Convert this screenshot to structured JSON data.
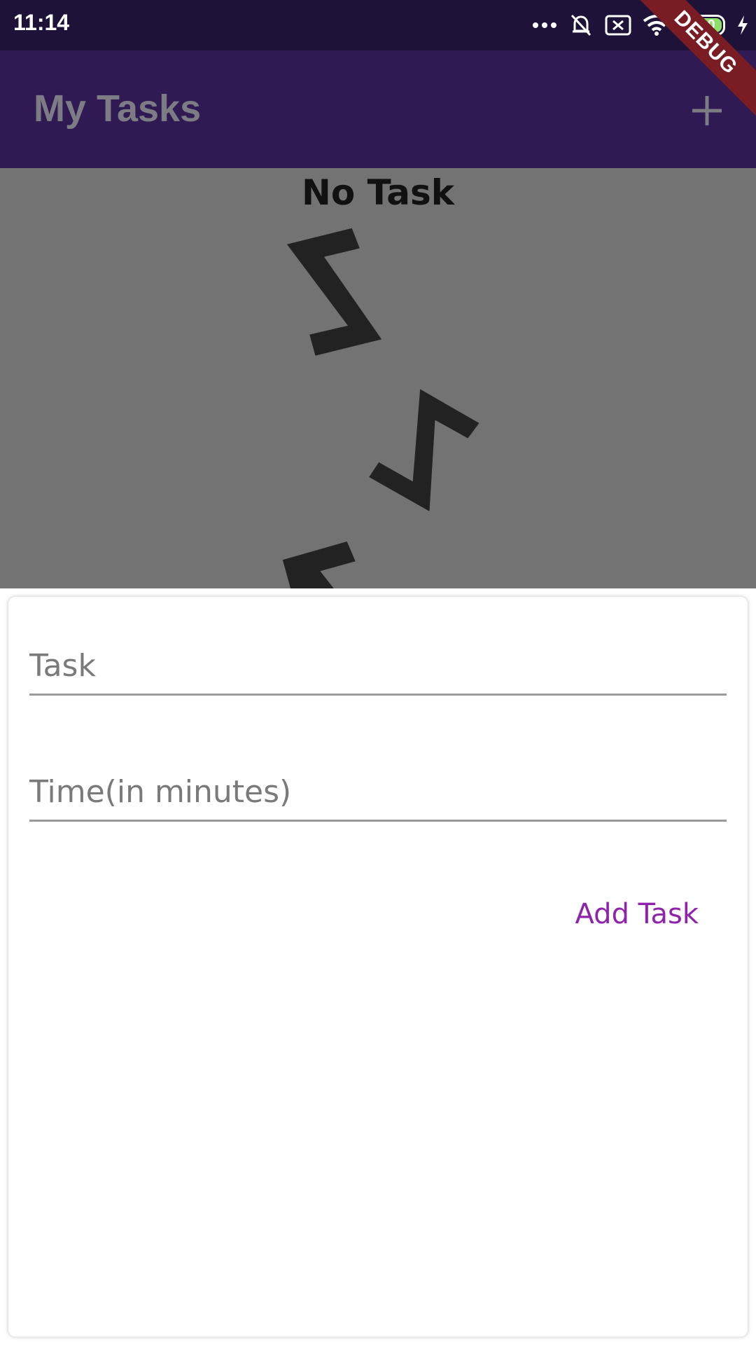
{
  "status_bar": {
    "time": "11:14",
    "battery_level": "100"
  },
  "app_bar": {
    "title": "My Tasks",
    "add_icon": "plus-icon"
  },
  "debug_banner": "DEBUG",
  "empty_state": {
    "title": "No Task",
    "illustration": "zzz-sleep-image"
  },
  "add_task_sheet": {
    "task_placeholder": "Task",
    "time_placeholder": "Time(in minutes)",
    "submit_label": "Add Task"
  },
  "colors": {
    "status_bar": "#1e1239",
    "app_bar": "#2f1a54",
    "scrim": "#737373",
    "accent": "#8e24aa",
    "debug": "#7a1c24"
  }
}
